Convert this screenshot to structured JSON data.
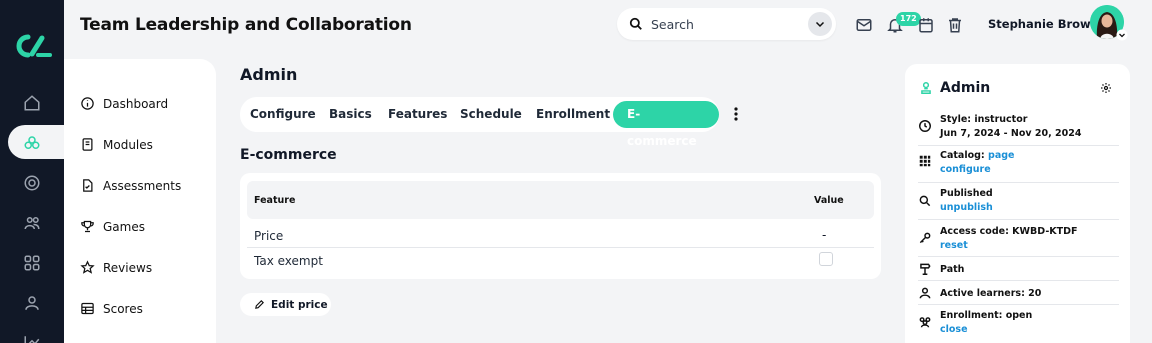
{
  "header": {
    "title": "Team Leadership and Collaboration",
    "search_placeholder": "Search",
    "notifications_count": "172",
    "user_name": "Stephanie Brown"
  },
  "rail": {
    "items": [
      "home-icon",
      "modules-icon",
      "target-icon",
      "users-icon",
      "apps-icon",
      "user-icon",
      "chart-icon"
    ],
    "active": "modules-icon"
  },
  "sidebar": {
    "items": [
      {
        "label": "Dashboard",
        "icon": "info-icon"
      },
      {
        "label": "Modules",
        "icon": "book-icon"
      },
      {
        "label": "Assessments",
        "icon": "doc-icon"
      },
      {
        "label": "Games",
        "icon": "trophy-icon"
      },
      {
        "label": "Reviews",
        "icon": "star-icon"
      },
      {
        "label": "Scores",
        "icon": "table-icon"
      }
    ]
  },
  "main": {
    "heading": "Admin",
    "tabs": [
      "Configure",
      "Basics",
      "Features",
      "Schedule",
      "Enrollment",
      "E-commerce"
    ],
    "active_tab": "E-commerce",
    "section_title": "E-commerce",
    "table": {
      "columns": [
        "Feature",
        "Value"
      ],
      "rows": [
        {
          "feature": "Price",
          "value": "-"
        },
        {
          "feature": "Tax exempt",
          "value": ""
        }
      ]
    },
    "edit_button": "Edit price"
  },
  "right_panel": {
    "title": "Admin",
    "style_label": "Style: instructor",
    "date_range": "Jun 7, 2024 - Nov 20, 2024",
    "catalog_label": "Catalog:",
    "catalog_link": "page",
    "catalog_action": "configure",
    "published_label": "Published",
    "published_action": "unpublish",
    "access_label": "Access code: KWBD-KTDF",
    "access_action": "reset",
    "path_label": "Path",
    "learners_label": "Active learners: 20",
    "enrollment_label": "Enrollment: open",
    "enrollment_action": "close"
  },
  "colors": {
    "accent": "#2dd4a7",
    "rail_bg": "#111827",
    "link": "#1a8fd6",
    "page_bg": "#f3f4f6"
  }
}
